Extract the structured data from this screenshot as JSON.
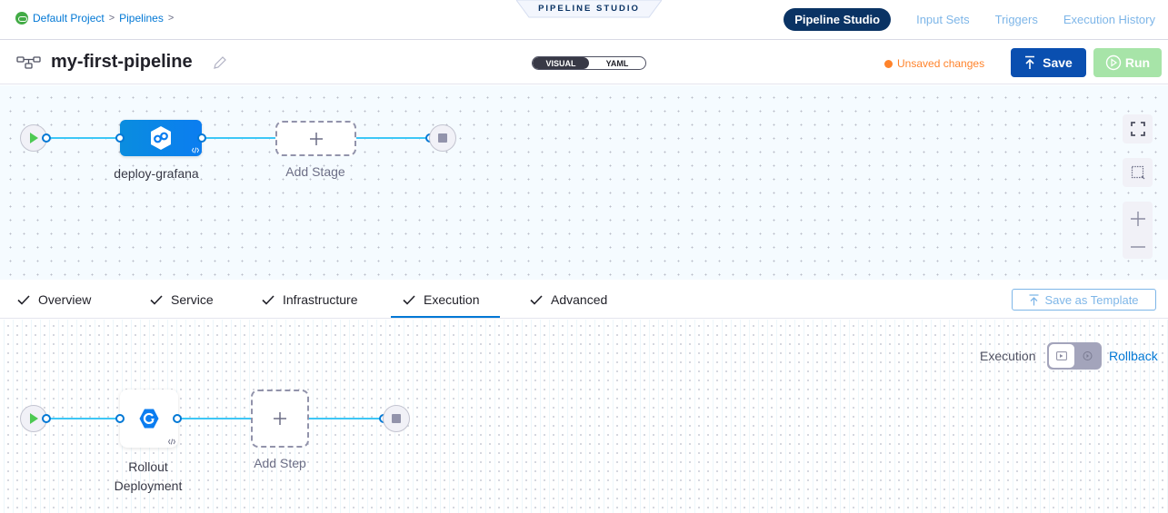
{
  "breadcrumb": {
    "project": "Default Project",
    "section": "Pipelines",
    "separator": ">"
  },
  "studio_tab": "PIPELINE STUDIO",
  "nav": {
    "tabs": [
      {
        "label": "Pipeline Studio",
        "active": true
      },
      {
        "label": "Input Sets",
        "active": false
      },
      {
        "label": "Triggers",
        "active": false
      },
      {
        "label": "Execution History",
        "active": false
      }
    ]
  },
  "header": {
    "pipeline_name": "my-first-pipeline",
    "view_options": [
      "VISUAL",
      "YAML"
    ],
    "selected_view": "VISUAL",
    "status": "Unsaved changes",
    "save_label": "Save",
    "run_label": "Run"
  },
  "pipeline_graph": {
    "stages": [
      {
        "name": "deploy-grafana",
        "icon": "deploy-stage-icon"
      }
    ],
    "add_stage_label": "Add Stage",
    "add_icon": "+"
  },
  "stage_tabs": {
    "tabs": [
      {
        "label": "Overview",
        "done": true
      },
      {
        "label": "Service",
        "done": true
      },
      {
        "label": "Infrastructure",
        "done": true
      },
      {
        "label": "Execution",
        "done": true,
        "active": true
      },
      {
        "label": "Advanced",
        "done": true
      }
    ],
    "save_as_template": "Save as Template"
  },
  "execution": {
    "toggle_label_left": "Execution",
    "toggle_label_right": "Rollback",
    "mode": "Execution",
    "steps": [
      {
        "name_line1": "Rollout",
        "name_line2": "Deployment",
        "icon": "rollout-icon"
      }
    ],
    "add_step_label": "Add Step"
  },
  "colors": {
    "primary": "#0278d5",
    "nav_active": "#0a3364",
    "save_button": "#0a4fb0",
    "run_button_disabled": "#a7e4a8",
    "unsaved": "#ff832b",
    "edge": "#3dc7f6"
  }
}
